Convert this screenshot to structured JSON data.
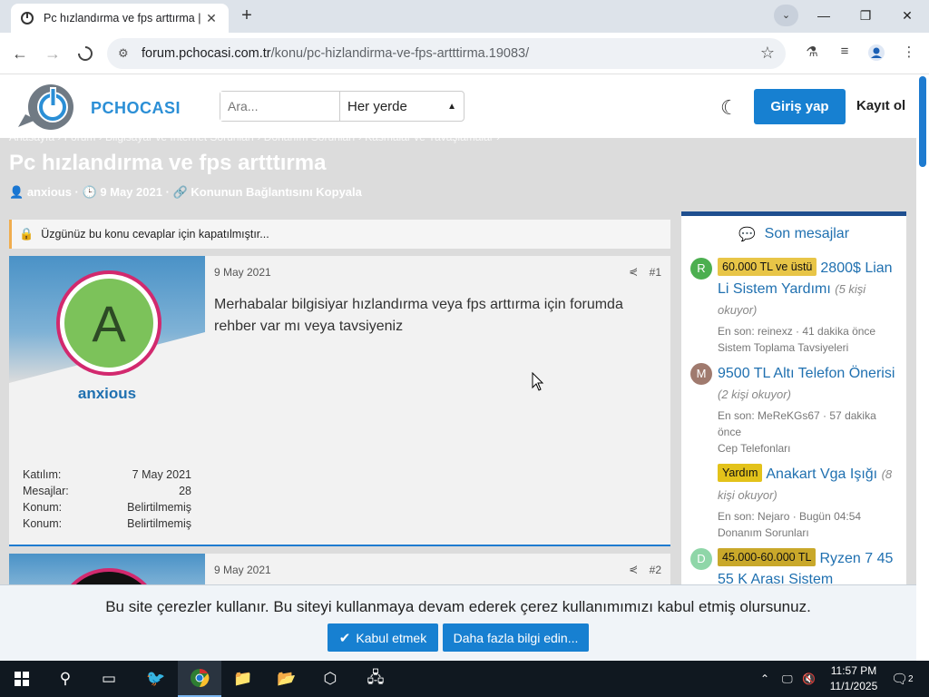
{
  "browser": {
    "tab_title": "Pc hızlandırma ve fps arttırma |",
    "url_domain": "forum.pchocasi.com.tr",
    "url_path": "/konu/pc-hizlandirma-ve-fps-artttirma.19083/"
  },
  "header": {
    "brand": "PCHOCASI",
    "search_placeholder": "Ara...",
    "search_scope": "Her yerde",
    "login_label": "Giriş yap",
    "register_label": "Kayıt ol"
  },
  "thread": {
    "breadcrumb": "Anasayfa  ›  Forum  ›  Bilgisayar ve İnternet Sorunları  ›  Donanım Sorunları  ›  Kasmalar ve Yavaşlamalar  ›",
    "title": "Pc hızlandırma ve fps artttırma",
    "author": "anxious",
    "date": "9 May 2021",
    "link_label": "Konunun Bağlantısını Kopyala",
    "locked_notice": "Üzgünüz bu konu cevaplar için kapatılmıştır..."
  },
  "posts": [
    {
      "avatar_letter": "A",
      "username": "anxious",
      "date": "9 May 2021",
      "number": "#1",
      "body": "Merhabalar bilgisiyar hızlandırma veya fps arttırma için forumda rehber var mı veya tavsiyeniz",
      "stats": [
        {
          "label": "Katılım:",
          "value": "7 May 2021"
        },
        {
          "label": "Mesajlar:",
          "value": "28"
        },
        {
          "label": "Konum:",
          "value": "Belirtilmemiş"
        },
        {
          "label": "Konum:",
          "value": "Belirtilmemiş"
        }
      ]
    },
    {
      "date": "9 May 2021",
      "number": "#2"
    }
  ],
  "sidebar": {
    "heading": "Son mesajlar",
    "items": [
      {
        "avatar": "R",
        "avatar_color": "#4caf50",
        "prefix": "60.000 TL ve üstü",
        "prefix_color": "#e8c547",
        "title": "2800$ Lian Li Sistem Yardımı",
        "reading": "(5 kişi okuyor)",
        "meta": "En son: reinexz · 41 dakika önce",
        "forum": "Sistem Toplama Tavsiyeleri"
      },
      {
        "avatar": "M",
        "avatar_color": "#a07a6e",
        "prefix": "",
        "title": "9500 TL Altı Telefon Önerisi",
        "reading": "(2 kişi okuyor)",
        "meta": "En son: MeReKGs67 · 57 dakika önce",
        "forum": "Cep Telefonları"
      },
      {
        "avatar": "",
        "prefix": "Yardım",
        "prefix_color": "#e3c21a",
        "title": "Anakart Vga Işığı",
        "reading": "(8 kişi okuyor)",
        "meta": "En son: Nejaro · Bugün 04:54",
        "forum": "Donanım Sorunları"
      },
      {
        "avatar": "D",
        "avatar_color": "#8fd6a8",
        "prefix": "45.000-60.000 TL",
        "prefix_color": "#c9a82a",
        "title": "Ryzen 7 45 55 K Arası Sistem",
        "reading": "",
        "meta": "",
        "forum": ""
      }
    ]
  },
  "cookie": {
    "message": "Bu site çerezler kullanır. Bu siteyi kullanmaya devam ederek çerez kullanımımızı kabul etmiş olursunuz.",
    "accept_label": "Kabul etmek",
    "more_label": "Daha fazla bilgi edin..."
  },
  "taskbar": {
    "time": "11:57 PM",
    "date": "11/1/2025",
    "notification_count": "2"
  }
}
